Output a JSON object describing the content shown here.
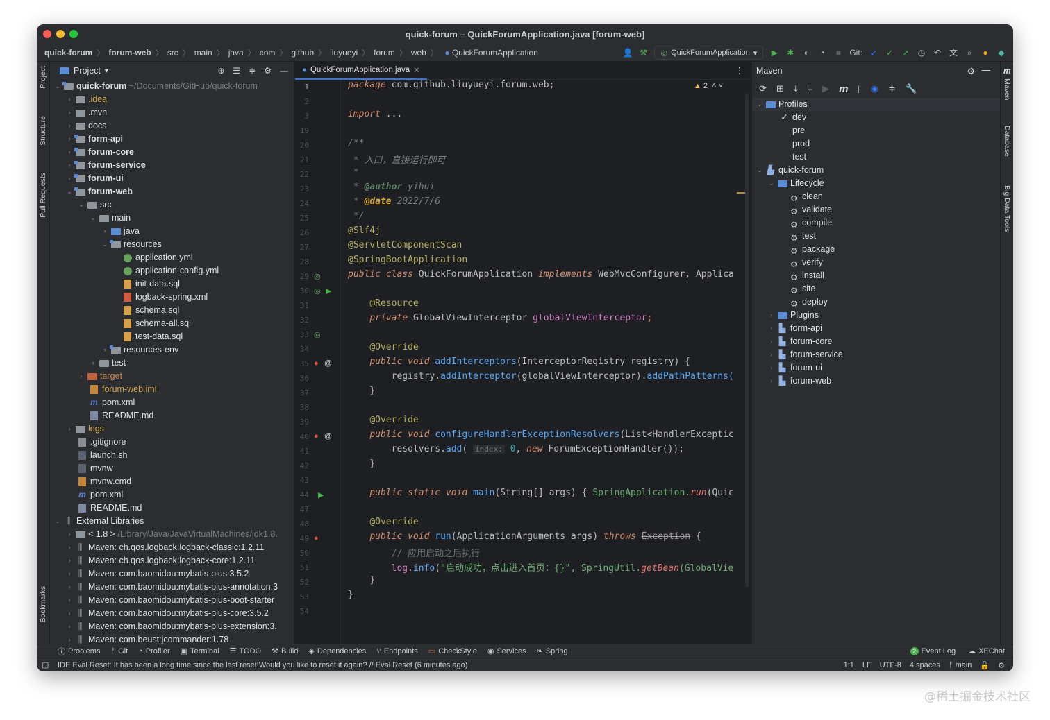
{
  "window": {
    "title": "quick-forum – QuickForumApplication.java [forum-web]"
  },
  "breadcrumb": [
    "quick-forum",
    "forum-web",
    "src",
    "main",
    "java",
    "com",
    "github",
    "liuyueyi",
    "forum",
    "web",
    "QuickForumApplication"
  ],
  "toolbar": {
    "run_config": "QuickForumApplication",
    "git_label": "Git:"
  },
  "left_tabs": [
    "Project",
    "Structure",
    "Pull Requests",
    "Bookmarks"
  ],
  "right_tabs": [
    "Maven",
    "Database",
    "Big Data Tools"
  ],
  "project": {
    "header": "Project",
    "root": {
      "name": "quick-forum",
      "path": "~/Documents/GitHub/quick-forum"
    },
    "items": [
      {
        "name": ".idea"
      },
      {
        "name": ".mvn"
      },
      {
        "name": "docs"
      },
      {
        "name": "form-api"
      },
      {
        "name": "forum-core"
      },
      {
        "name": "forum-service"
      },
      {
        "name": "forum-ui"
      },
      {
        "name": "forum-web"
      },
      {
        "name": "src"
      },
      {
        "name": "main"
      },
      {
        "name": "java"
      },
      {
        "name": "resources"
      },
      {
        "name": "application.yml"
      },
      {
        "name": "application-config.yml"
      },
      {
        "name": "init-data.sql"
      },
      {
        "name": "logback-spring.xml"
      },
      {
        "name": "schema.sql"
      },
      {
        "name": "schema-all.sql"
      },
      {
        "name": "test-data.sql"
      },
      {
        "name": "resources-env"
      },
      {
        "name": "test"
      },
      {
        "name": "target"
      },
      {
        "name": "forum-web.iml"
      },
      {
        "name": "pom.xml"
      },
      {
        "name": "README.md"
      },
      {
        "name": "logs"
      },
      {
        "name": ".gitignore"
      },
      {
        "name": "launch.sh"
      },
      {
        "name": "mvnw"
      },
      {
        "name": "mvnw.cmd"
      },
      {
        "name": "pom.xml"
      },
      {
        "name": "README.md"
      },
      {
        "name": "External Libraries"
      },
      {
        "name": "< 1.8 >"
      },
      {
        "name": "Maven: ch.qos.logback:logback-classic:1.2.11"
      },
      {
        "name": "Maven: ch.qos.logback:logback-core:1.2.11"
      },
      {
        "name": "Maven: com.baomidou:mybatis-plus:3.5.2"
      },
      {
        "name": "Maven: com.baomidou:mybatis-plus-annotation:3"
      },
      {
        "name": "Maven: com.baomidou:mybatis-plus-boot-starter"
      },
      {
        "name": "Maven: com.baomidou:mybatis-plus-core:3.5.2"
      },
      {
        "name": "Maven: com.baomidou:mybatis-plus-extension:3."
      },
      {
        "name": "Maven: com.beust:jcommander:1.78"
      }
    ],
    "jdk_path": "/Library/Java/JavaVirtualMachines/jdk1.8."
  },
  "editor": {
    "tab": "QuickForumApplication.java",
    "warnings": "2",
    "line_numbers": [
      "1",
      "2",
      "3",
      "19",
      "20",
      "21",
      "22",
      "23",
      "24",
      "25",
      "26",
      "27",
      "28",
      "29",
      "30",
      "31",
      "32",
      "33",
      "34",
      "35",
      "36",
      "37",
      "38",
      "39",
      "40",
      "41",
      "42",
      "43",
      "44",
      "47",
      "48",
      "49",
      "50",
      "51",
      "52",
      "53",
      "54"
    ],
    "code": {
      "pkg_kw": "package",
      "pkg": "com.github.liuyueyi.forum.web;",
      "import_kw": "import",
      "import_rest": "...",
      "doc_open": "/**",
      "doc_1": " * 入口，直接运行即可",
      "doc_2": " *",
      "doc_author_tag": "@author",
      "doc_author": "yihui",
      "doc_date_tag": "@date",
      "doc_date": "2022/7/6",
      "doc_close": " */",
      "ann_1": "@Slf4j",
      "ann_2": "@ServletComponentScan",
      "ann_3": "@SpringBootApplication",
      "cls_decl_public": "public",
      "cls_decl_class": "class",
      "cls_name": "QuickForumApplication",
      "cls_implements": "implements",
      "cls_ifaces": "WebMvcConfigurer, Applica",
      "resource_ann": "@Resource",
      "field_private": "private",
      "field_type": "GlobalViewInterceptor",
      "field_name": "globalViewInterceptor",
      "override": "@Override",
      "m1_public": "public",
      "m1_void": "void",
      "m1_name": "addInterceptors",
      "m1_params": "InterceptorRegistry registry) {",
      "m1_body_a": "registry.",
      "m1_body_b": "addInterceptor",
      "m1_body_c": "(globalViewInterceptor).",
      "m1_body_d": "addPathPatterns(",
      "close_brace": "}",
      "m2_name": "configureHandlerExceptionResolvers",
      "m2_params": "(List<HandlerExceptic",
      "m2_body_a": "resolvers.",
      "m2_body_b": "add",
      "m2_hint": "index:",
      "m2_num": "0",
      "m2_new": "new",
      "m2_body_c": "ForumExceptionHandler());",
      "main_static": "static",
      "main_name": "main",
      "main_params": "(String[] args) {",
      "main_body_a": "SpringApplication.",
      "main_body_b": "run",
      "main_body_c": "(Quic",
      "run_name": "run",
      "run_params": "(ApplicationArguments args)",
      "throws": "throws",
      "exception": "Exception",
      "run_brace": "{",
      "run_comment": "// 应用启动之后执行",
      "log_a": "log.",
      "log_b": "info",
      "log_str": "\"启动成功，点击进入首页：{}\"",
      "log_c": ", SpringUtil.",
      "log_d": "getBean",
      "log_e": "(GlobalVie"
    }
  },
  "maven": {
    "header": "Maven",
    "profiles_label": "Profiles",
    "profiles": [
      {
        "name": "dev",
        "checked": true
      },
      {
        "name": "pre",
        "checked": false
      },
      {
        "name": "prod",
        "checked": false
      },
      {
        "name": "test",
        "checked": false
      }
    ],
    "project": "quick-forum",
    "lifecycle_label": "Lifecycle",
    "lifecycle": [
      "clean",
      "validate",
      "compile",
      "test",
      "package",
      "verify",
      "install",
      "site",
      "deploy"
    ],
    "plugins_label": "Plugins",
    "modules": [
      "form-api",
      "forum-core",
      "forum-service",
      "forum-ui",
      "forum-web"
    ]
  },
  "bottom_tools": [
    "Problems",
    "Git",
    "Profiler",
    "Terminal",
    "TODO",
    "Build",
    "Dependencies",
    "Endpoints",
    "CheckStyle",
    "Services",
    "Spring"
  ],
  "bottom_right": {
    "event_log": "Event Log",
    "event_count": "2",
    "xechat": "XEChat"
  },
  "status": {
    "message": "IDE Eval Reset: It has been a long time since the last reset!Would you like to reset it again? // Eval Reset (6 minutes ago)",
    "position": "1:1",
    "line_sep": "LF",
    "encoding": "UTF-8",
    "indent": "4 spaces",
    "branch": "main"
  },
  "watermark": "@稀土掘金技术社区",
  "colors": {
    "accent": "#3574f0",
    "run_green": "#4caf50",
    "bg": "#1e1f22",
    "panel": "#2b2d30"
  }
}
